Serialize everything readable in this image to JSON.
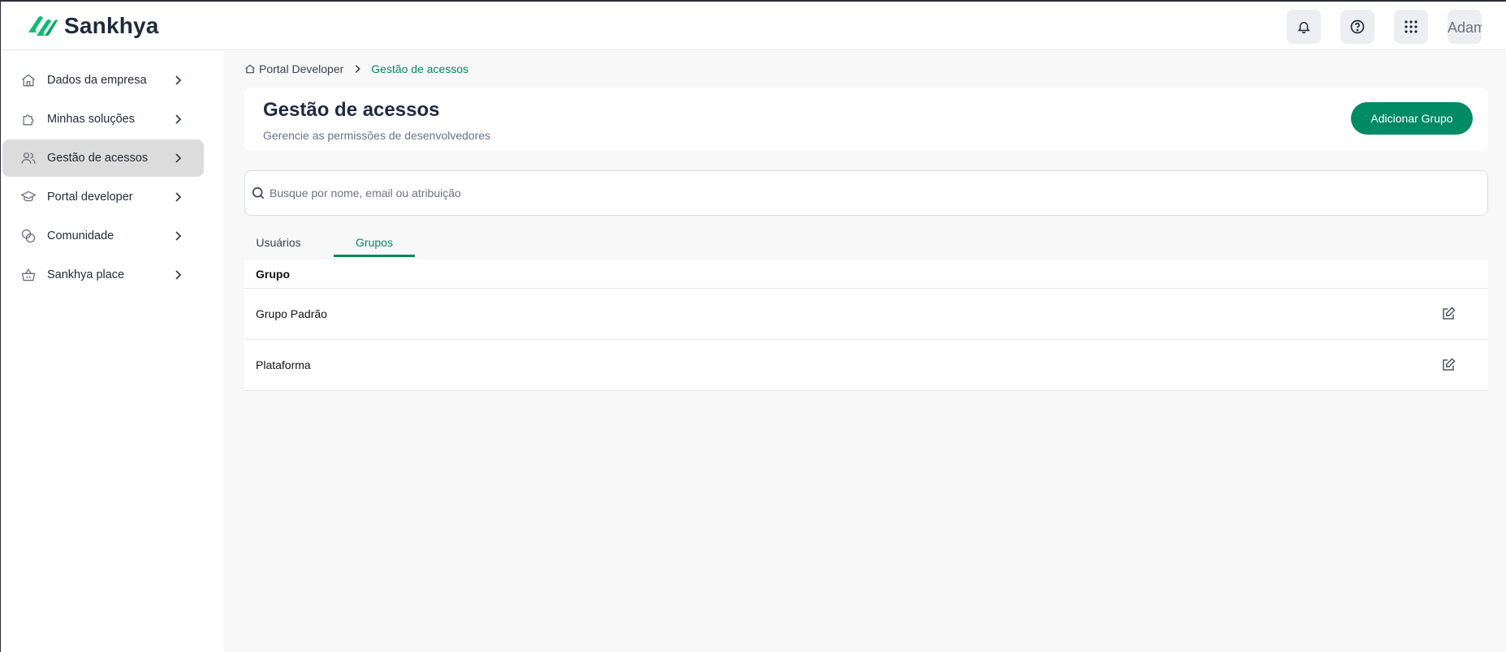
{
  "brand": {
    "name": "Sankhya",
    "color": "#00c16e"
  },
  "header": {
    "icons": [
      "bell-icon",
      "help-icon",
      "apps-grid-icon"
    ],
    "avatar_alt": "Adam"
  },
  "sidebar": {
    "items": [
      {
        "label": "Dados da empresa",
        "icon": "home-icon"
      },
      {
        "label": "Minhas soluções",
        "icon": "puzzle-icon"
      },
      {
        "label": "Gestão de acessos",
        "icon": "users-icon",
        "active": true
      },
      {
        "label": "Portal developer",
        "icon": "graduation-cap-icon"
      },
      {
        "label": "Comunidade",
        "icon": "chat-bubbles-icon"
      },
      {
        "label": "Sankhya place",
        "icon": "basket-icon"
      }
    ]
  },
  "breadcrumb": {
    "parent": "Portal Developer",
    "current": "Gestão de acessos"
  },
  "page": {
    "title": "Gestão de acessos",
    "subtitle": "Gerencie as permissões de desenvolvedores",
    "primary_button": "Adicionar Grupo"
  },
  "search": {
    "placeholder": "Busque por nome, email ou atribuição",
    "value": ""
  },
  "tabs": [
    {
      "label": "Usuários",
      "active": false
    },
    {
      "label": "Grupos",
      "active": true
    }
  ],
  "table": {
    "columns": [
      "Grupo"
    ],
    "rows": [
      {
        "grupo": "Grupo Padrão"
      },
      {
        "grupo": "Plataforma"
      }
    ]
  },
  "colors": {
    "accent": "#00875f",
    "button": "#008b64",
    "active_nav": "#dcdcdc"
  }
}
